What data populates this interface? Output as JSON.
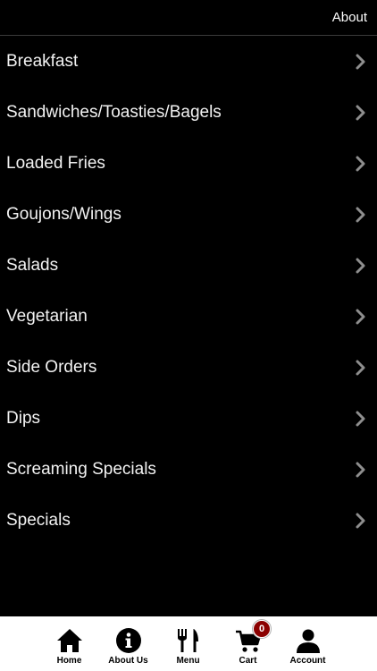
{
  "header": {
    "about_label": "About"
  },
  "menu": {
    "items": [
      {
        "label": "Breakfast"
      },
      {
        "label": "Sandwiches/Toasties/Bagels"
      },
      {
        "label": "Loaded Fries"
      },
      {
        "label": "Goujons/Wings"
      },
      {
        "label": "Salads"
      },
      {
        "label": "Vegetarian"
      },
      {
        "label": "Side Orders"
      },
      {
        "label": "Dips"
      },
      {
        "label": "Screaming Specials"
      },
      {
        "label": "Specials"
      }
    ]
  },
  "tabbar": {
    "tabs": [
      {
        "label": "Home",
        "icon": "home-icon"
      },
      {
        "label": "About Us",
        "icon": "info-icon"
      },
      {
        "label": "Menu",
        "icon": "fork-knife-icon"
      },
      {
        "label": "Cart",
        "icon": "cart-icon"
      },
      {
        "label": "Account",
        "icon": "person-icon"
      }
    ],
    "cart_count": "0"
  },
  "colors": {
    "background": "#000000",
    "text": "#f2f2f2",
    "chevron": "#8e8e8e",
    "tabbar_background": "#ffffff",
    "badge": "#8b0000"
  }
}
